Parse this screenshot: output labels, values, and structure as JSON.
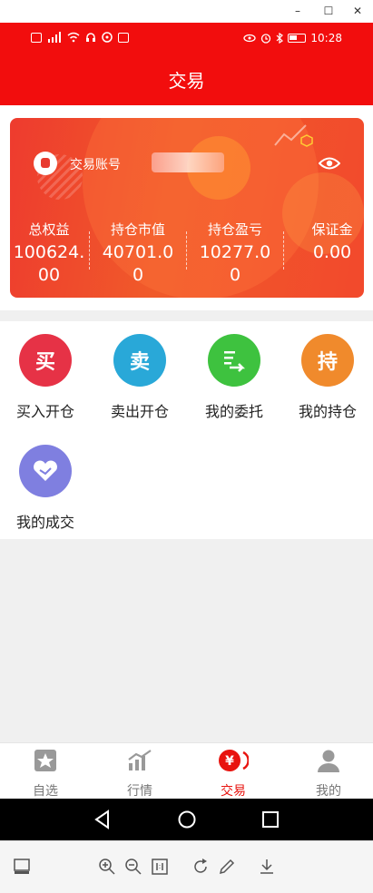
{
  "window": {
    "minimize": "–",
    "maximize": "☐",
    "close": "✕"
  },
  "status_bar": {
    "time": "10:28",
    "left_icons": [
      "HD",
      "4G",
      "signal",
      "wifi",
      "headset",
      "vpn",
      "notify"
    ],
    "right_icons": [
      "eye",
      "alarm",
      "bluetooth",
      "battery"
    ]
  },
  "header": {
    "title": "交易"
  },
  "account_card": {
    "account_label": "交易账号",
    "stats": [
      {
        "label": "总权益",
        "value": "100624.00"
      },
      {
        "label": "持仓市值",
        "value": "40701.00"
      },
      {
        "label": "持仓盈亏",
        "value": "10277.00"
      },
      {
        "label": "保证金",
        "value": "0.00"
      }
    ]
  },
  "actions": [
    {
      "icon": "buy-icon",
      "glyph": "买",
      "label": "买入开仓",
      "color": "#e63246"
    },
    {
      "icon": "sell-icon",
      "glyph": "卖",
      "label": "卖出开仓",
      "color": "#29a8d8"
    },
    {
      "icon": "orders-icon",
      "glyph": "",
      "label": "我的委托",
      "color": "#3ec23f"
    },
    {
      "icon": "position-icon",
      "glyph": "持",
      "label": "我的持仓",
      "color": "#f08a2c"
    },
    {
      "icon": "handshake-icon",
      "glyph": "",
      "label": "我的成交",
      "color": "#7f7fe0"
    }
  ],
  "bottom_nav": [
    {
      "label": "自选",
      "icon": "star-icon",
      "active": false
    },
    {
      "label": "行情",
      "icon": "chart-icon",
      "active": false
    },
    {
      "label": "交易",
      "icon": "yen-icon",
      "active": true
    },
    {
      "label": "我的",
      "icon": "user-icon",
      "active": false
    }
  ],
  "colors": {
    "brand": "#f20d0d",
    "active_nav": "#e8140f"
  }
}
